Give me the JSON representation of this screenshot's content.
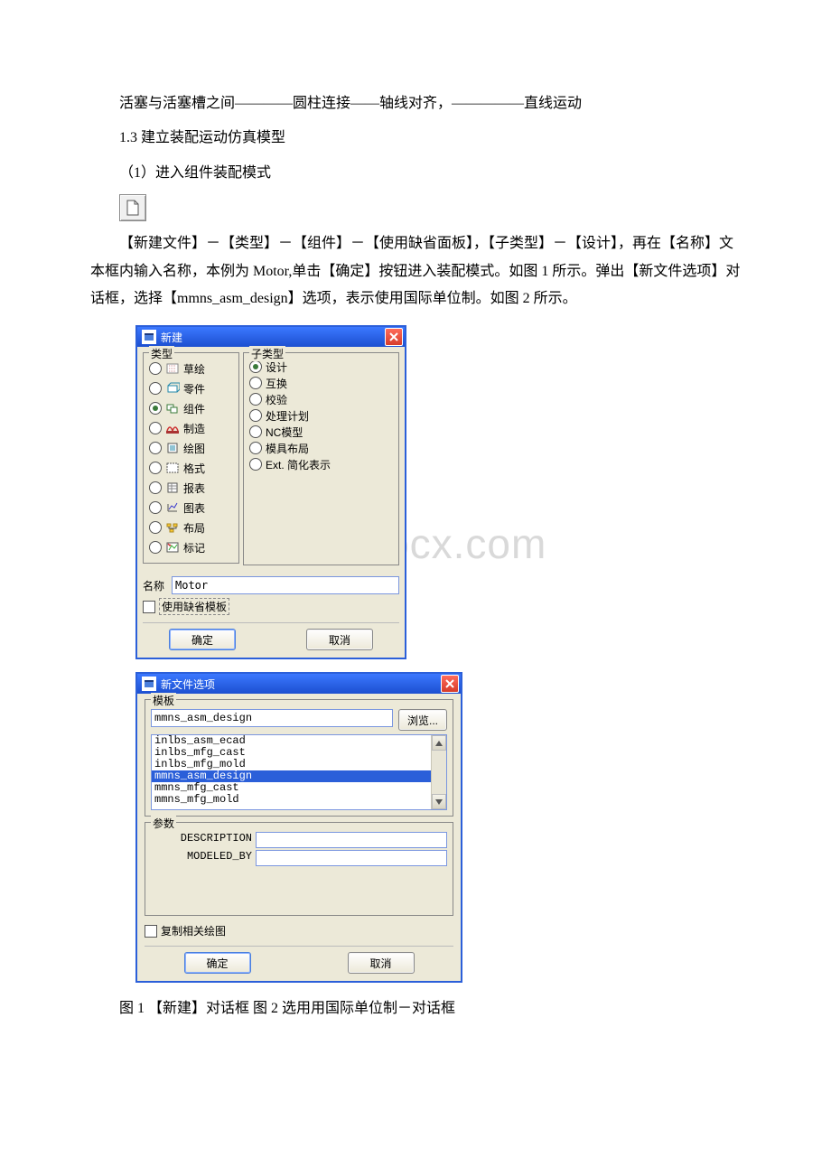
{
  "text": {
    "p1": "活塞与活塞槽之间————圆柱连接——轴线对齐，—————直线运动",
    "p2": "1.3 建立装配运动仿真模型",
    "p3": "（1）进入组件装配模式",
    "p4": "【新建文件】－【类型】－【组件】－【使用缺省面板】，【子类型】－【设计】，再在【名称】文本框内输入名称，本例为 Motor,单击【确定】按钮进入装配模式。如图 1 所示。弹出【新文件选项】对话框，选择【mmns_asm_design】选项，表示使用国际单位制。如图 2 所示。",
    "caption": "图 1 【新建】对话框  图 2 选用用国际单位制－对话框"
  },
  "watermark": "www.bdocx.com",
  "dialog1": {
    "title": "新建",
    "group_type_label": "类型",
    "group_subtype_label": "子类型",
    "types": [
      {
        "label": "草绘",
        "checked": false
      },
      {
        "label": "零件",
        "checked": false
      },
      {
        "label": "组件",
        "checked": true
      },
      {
        "label": "制造",
        "checked": false
      },
      {
        "label": "绘图",
        "checked": false
      },
      {
        "label": "格式",
        "checked": false
      },
      {
        "label": "报表",
        "checked": false
      },
      {
        "label": "图表",
        "checked": false
      },
      {
        "label": "布局",
        "checked": false
      },
      {
        "label": "标记",
        "checked": false
      }
    ],
    "subtypes": [
      {
        "label": "设计",
        "checked": true
      },
      {
        "label": "互换",
        "checked": false
      },
      {
        "label": "校验",
        "checked": false
      },
      {
        "label": "处理计划",
        "checked": false
      },
      {
        "label": "NC模型",
        "checked": false
      },
      {
        "label": "模具布局",
        "checked": false
      },
      {
        "label": "Ext. 简化表示",
        "checked": false
      }
    ],
    "name_label": "名称",
    "name_value": "Motor",
    "use_default_template": "使用缺省模板",
    "ok": "确定",
    "cancel": "取消"
  },
  "dialog2": {
    "title": "新文件选项",
    "group_template_label": "模板",
    "template_value": "mmns_asm_design",
    "browse": "浏览...",
    "template_list": [
      "inlbs_asm_ecad",
      "inlbs_mfg_cast",
      "inlbs_mfg_mold",
      "mmns_asm_design",
      "mmns_mfg_cast",
      "mmns_mfg_mold"
    ],
    "selected_index": 3,
    "group_params_label": "参数",
    "param1_label": "DESCRIPTION",
    "param2_label": "MODELED_BY",
    "copy_drawings": "复制相关绘图",
    "ok": "确定",
    "cancel": "取消"
  }
}
